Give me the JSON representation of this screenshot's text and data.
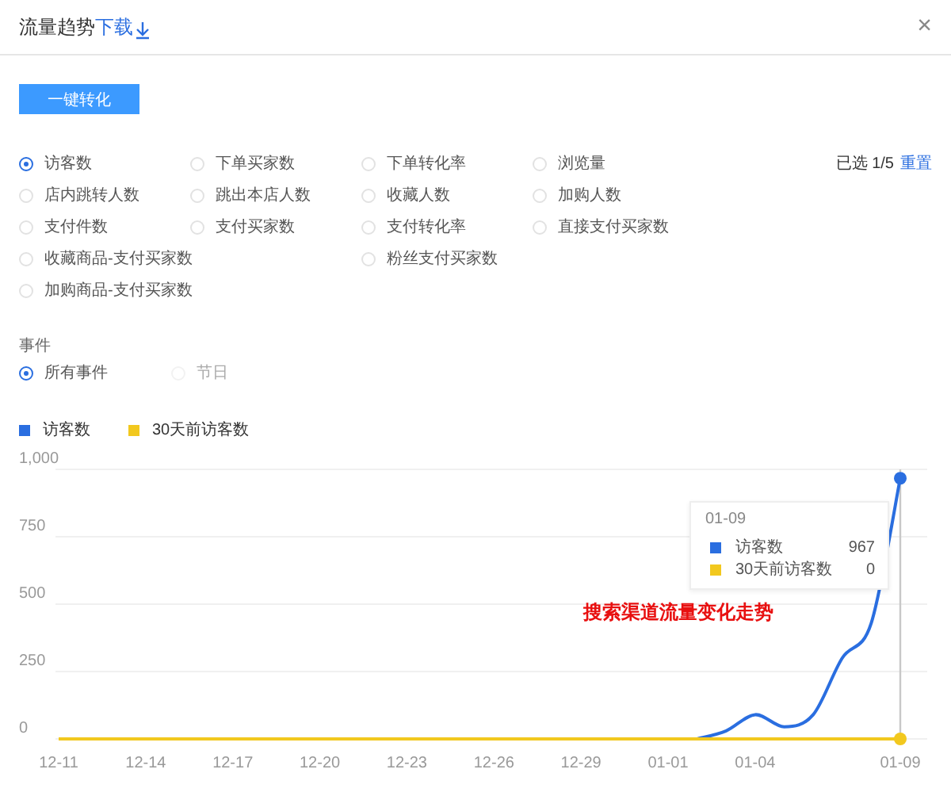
{
  "dialog": {
    "title": "流量趋势",
    "download_link": "下载",
    "close": "×"
  },
  "convert_button": "一键转化",
  "metrics": [
    {
      "label": "访客数",
      "selected": true
    },
    {
      "label": "下单买家数",
      "selected": false
    },
    {
      "label": "下单转化率",
      "selected": false
    },
    {
      "label": "浏览量",
      "selected": false
    },
    {
      "label": "店内跳转人数",
      "selected": false
    },
    {
      "label": "跳出本店人数",
      "selected": false
    },
    {
      "label": "收藏人数",
      "selected": false
    },
    {
      "label": "加购人数",
      "selected": false
    },
    {
      "label": "支付件数",
      "selected": false
    },
    {
      "label": "支付买家数",
      "selected": false
    },
    {
      "label": "支付转化率",
      "selected": false
    },
    {
      "label": "直接支付买家数",
      "selected": false
    },
    {
      "label": "收藏商品-支付买家数",
      "selected": false
    },
    {
      "label": "粉丝支付买家数",
      "selected": false
    },
    {
      "label": "加购商品-支付买家数",
      "selected": false
    }
  ],
  "selection_count": "已选 1/5",
  "reset_link": "重置",
  "events": {
    "label": "事件",
    "options": [
      {
        "label": "所有事件",
        "selected": true
      },
      {
        "label": "节日",
        "selected": false
      }
    ]
  },
  "chart": {
    "chart_data": {
      "type": "line",
      "categories": [
        "12-11",
        null,
        null,
        "12-14",
        null,
        null,
        "12-17",
        null,
        null,
        "12-20",
        null,
        null,
        "12-23",
        null,
        null,
        "12-26",
        null,
        null,
        "12-29",
        null,
        null,
        "01-01",
        null,
        null,
        "01-04",
        null,
        null,
        null,
        null,
        "01-09"
      ],
      "series": [
        {
          "name": "访客数",
          "color": "#2a6ee0",
          "values": [
            null,
            null,
            null,
            null,
            null,
            null,
            null,
            null,
            null,
            null,
            null,
            null,
            null,
            null,
            null,
            null,
            null,
            null,
            null,
            null,
            null,
            null,
            0,
            30,
            90,
            45,
            90,
            300,
            430,
            967
          ]
        },
        {
          "name": "30天前访客数",
          "color": "#f2c81e",
          "values": [
            0,
            0,
            0,
            0,
            0,
            0,
            0,
            0,
            0,
            0,
            0,
            0,
            0,
            0,
            0,
            0,
            0,
            0,
            0,
            0,
            0,
            0,
            0,
            0,
            0,
            0,
            0,
            0,
            0,
            0
          ]
        }
      ],
      "ylim": [
        0,
        1000
      ],
      "yticks": [
        0,
        250,
        500,
        750,
        {
          "value": 1000,
          "label": "1,000"
        }
      ],
      "grid": true,
      "legend": true,
      "annotations": [
        "搜索渠道流量变化走势"
      ]
    },
    "tooltip": {
      "title": "01-09",
      "rows": [
        {
          "name": "访客数",
          "value": "967",
          "color": "#2a6ee0"
        },
        {
          "name": "30天前访客数",
          "value": "0",
          "color": "#f2c81e"
        }
      ]
    }
  }
}
